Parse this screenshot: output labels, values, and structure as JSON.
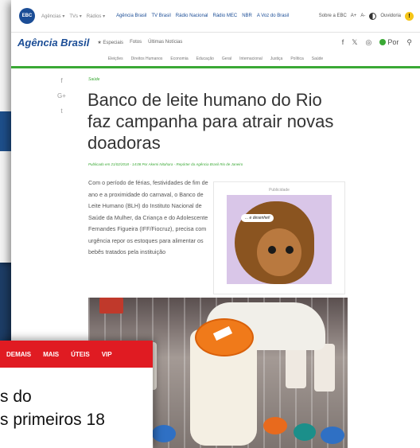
{
  "ebc_bar": {
    "logo": "EBC",
    "dropdowns": [
      "Agências ▾",
      "TVs ▾",
      "Rádios ▾"
    ],
    "network_links": [
      "Agência Brasil",
      "TV Brasil",
      "Rádio Nacional",
      "Rádio MEC",
      "NBR",
      "A Voz do Brasil"
    ],
    "about": "Sobre a EBC",
    "font_up": "A+",
    "font_down": "A-",
    "ombudsman": "Ouvidoria",
    "alert_icon": "!"
  },
  "ab_bar": {
    "logo": "Agência Brasil",
    "menu": [
      "★ Especiais",
      "Fotos",
      "Últimas Notícias"
    ],
    "social": [
      "f",
      "𝕏",
      "◎"
    ],
    "radio_label": "Por"
  },
  "sections": [
    "Eleições",
    "Direitos Humanos",
    "Economia",
    "Educação",
    "Geral",
    "Internacional",
    "Justiça",
    "Política",
    "Saúde"
  ],
  "article": {
    "tag": "Saúde",
    "headline": "Banco de leite humano do Rio faz campanha para atrair novas doadoras",
    "byline": "Publicado em 21/02/2018 - 14:08  Por Akemi Nitahara - Repórter da Agência Brasil  Rio de Janeiro",
    "body": "Com o período de férias, festividades de fim de ano e a proximidade do carnaval, o Banco de Leite Humano (BLH) do Instituto Nacional de Saúde da Mulher, da Criança e do Adolescente Fernandes Figueira (IFF/Fiocruz), precisa com urgência repor os estoques para alimentar os bebês tratados pela instituição",
    "share": [
      "f",
      "G+",
      "t"
    ]
  },
  "ad": {
    "label": "Publicidade",
    "bubble": "... e desenhei!"
  },
  "red_site": {
    "nav": [
      "DEMAIS",
      "MAIS",
      "ÚTEIS",
      "VIP"
    ],
    "line1": "s do",
    "line2": "s primeiros 18"
  }
}
